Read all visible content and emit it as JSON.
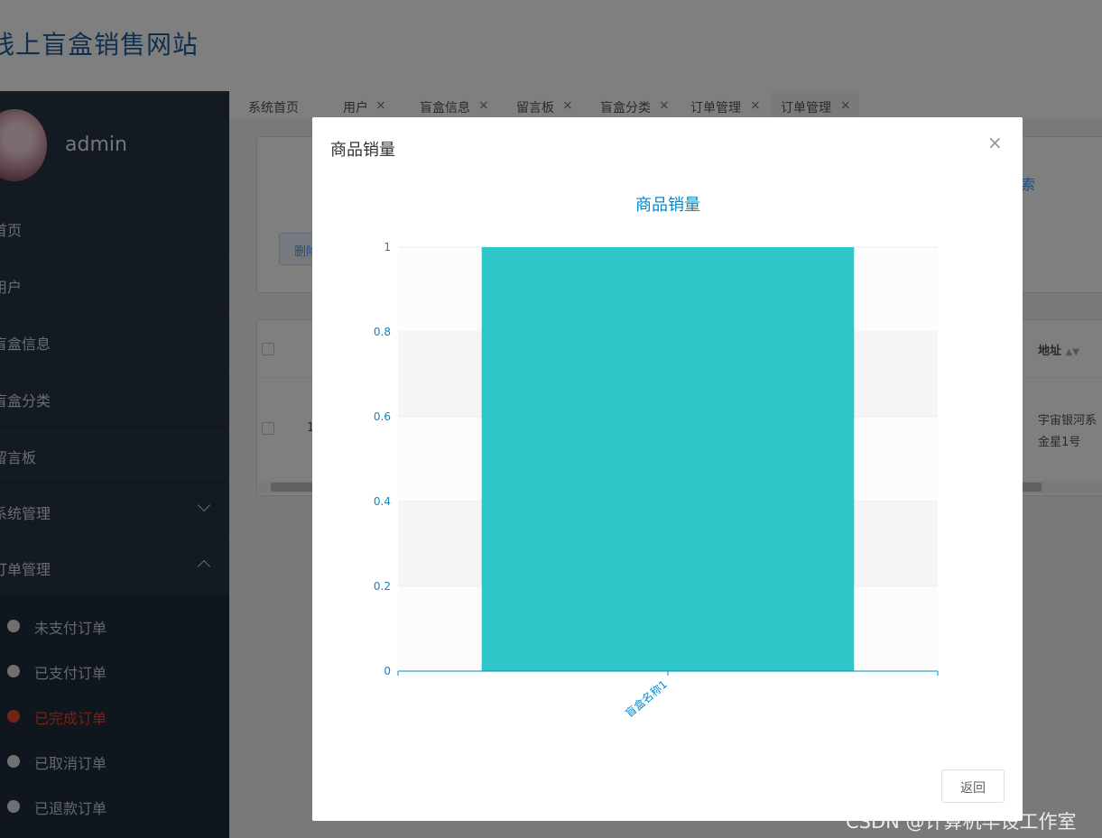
{
  "header": {
    "site_title": "线上盲盒销售网站"
  },
  "sidebar": {
    "username": "admin",
    "items": [
      {
        "label": "首页"
      },
      {
        "label": "用户"
      },
      {
        "label": "盲盒信息"
      },
      {
        "label": "盲盒分类"
      },
      {
        "label": "留言板"
      },
      {
        "label": "系统管理",
        "expanded": false
      },
      {
        "label": "订单管理",
        "expanded": true
      }
    ],
    "sub_items": [
      {
        "label": "未支付订单"
      },
      {
        "label": "已支付订单"
      },
      {
        "label": "已完成订单",
        "active": true
      },
      {
        "label": "已取消订单"
      },
      {
        "label": "已退款订单"
      }
    ]
  },
  "tabs": [
    {
      "label": "系统首页",
      "closable": false
    },
    {
      "label": "用户",
      "closable": true
    },
    {
      "label": "盲盒信息",
      "closable": true
    },
    {
      "label": "留言板",
      "closable": true
    },
    {
      "label": "盲盒分类",
      "closable": true
    },
    {
      "label": "订单管理",
      "closable": true
    },
    {
      "label": "订单管理",
      "closable": true,
      "active": true
    }
  ],
  "close_symbol": "×",
  "main": {
    "search_suffix": "索",
    "delete_partial": "删除",
    "table": {
      "row_number_partial": "1",
      "address_header": "地址",
      "address_line1": "宇宙银河系",
      "address_line2": "金星1号"
    }
  },
  "modal": {
    "title": "商品销量",
    "close_icon": "×",
    "return_label": "返回"
  },
  "chart_data": {
    "type": "bar",
    "title": "商品销量",
    "categories": [
      "盲盒名称1"
    ],
    "values": [
      1
    ],
    "ylim": [
      0,
      1
    ],
    "yticks": [
      "0",
      "0.2",
      "0.4",
      "0.6",
      "0.8",
      "1"
    ],
    "bar_color": "#2ec7c9",
    "axis_color": "#008acd",
    "grid": true
  },
  "watermark": "CSDN @计算机毕设工作室"
}
